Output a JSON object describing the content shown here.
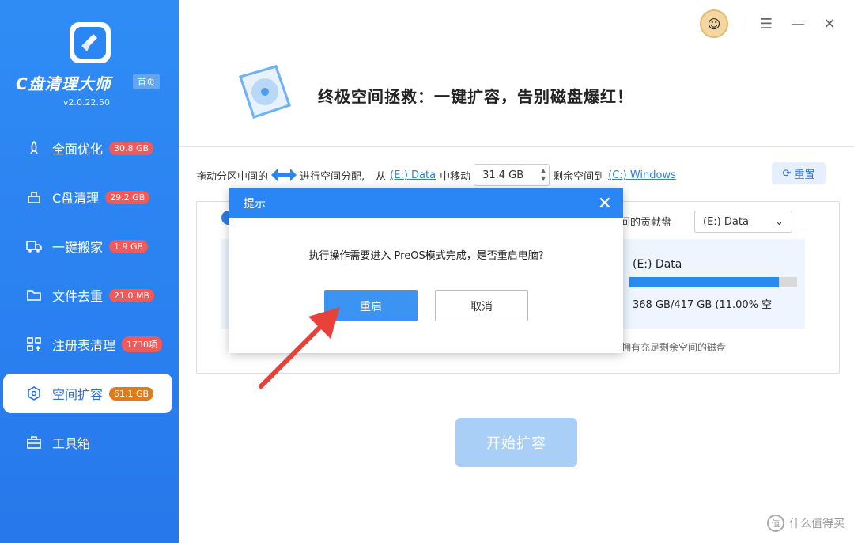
{
  "app": {
    "name": "C盘清理大师",
    "home_label": "首页",
    "version": "v2.0.22.50"
  },
  "sidebar": {
    "items": [
      {
        "label": "全面优化",
        "badge": "30.8 GB",
        "icon": "rocket-icon"
      },
      {
        "label": "C盘清理",
        "badge": "29.2 GB",
        "icon": "broom-icon"
      },
      {
        "label": "一键搬家",
        "badge": "1.9 GB",
        "icon": "truck-icon"
      },
      {
        "label": "文件去重",
        "badge": "21.0 MB",
        "icon": "folder-icon"
      },
      {
        "label": "注册表清理",
        "badge": "1730项",
        "icon": "registry-icon"
      },
      {
        "label": "空间扩容",
        "badge": "61.1 GB",
        "icon": "expand-icon"
      },
      {
        "label": "工具箱",
        "badge": "",
        "icon": "toolbox-icon"
      }
    ],
    "active_index": 5
  },
  "header": {
    "headline": "终极空间拯救：一键扩容，告别磁盘爆红！"
  },
  "controls": {
    "text_drag": "拖动分区中间的",
    "text_allocate": "进行空间分配,",
    "text_from": "从",
    "from_disk": "(E:) Data",
    "text_move": "中移动",
    "size_value": "31.4 GB",
    "text_to": "剩余空间到",
    "to_disk": "(C:) Windows",
    "reset_label": "重置"
  },
  "panel": {
    "contrib_label": "间的贡献盘",
    "select_value": "(E:) Data",
    "disk_name": "(E:) Data",
    "disk_usage_text": "368 GB/417 GB (11.00% 空",
    "disk_used_fraction": 0.89,
    "hint": "择拥有充足剩余空间的磁盘"
  },
  "start_button": "开始扩容",
  "dialog": {
    "title": "提示",
    "message": "执行操作需要进入 PreOS模式完成，是否重启电脑?",
    "ok_label": "重启",
    "cancel_label": "取消"
  },
  "watermark": "什么值得买",
  "colors": {
    "sidebar_blue": "#2a80f0",
    "accent": "#2a86f5",
    "badge_red": "#f05a5a",
    "badge_orange": "#e07a1a",
    "arrow_red": "#e8413a"
  }
}
